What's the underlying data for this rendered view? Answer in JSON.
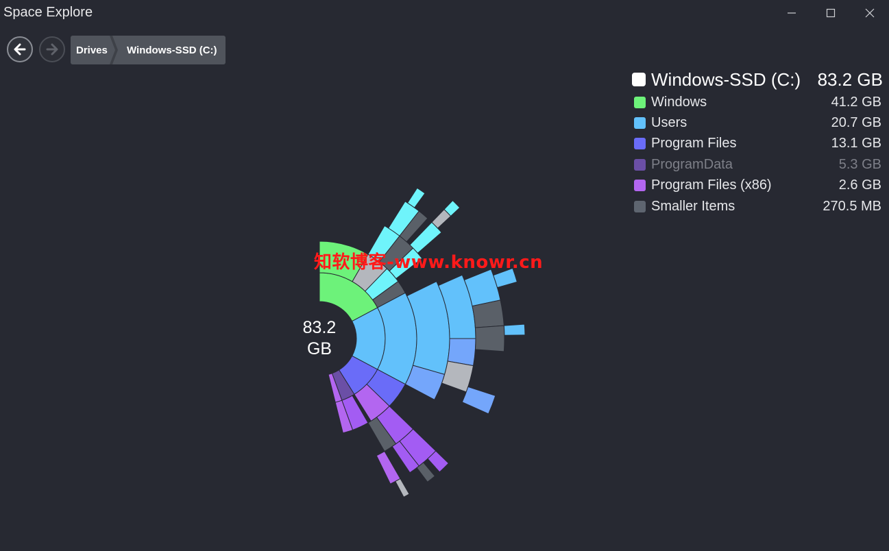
{
  "window": {
    "title": "Space Explore",
    "controls": [
      "minimize-icon",
      "maximize-icon",
      "close-icon"
    ]
  },
  "nav": {
    "back_icon": "arrow-left-icon",
    "forward_icon": "arrow-right-icon",
    "breadcrumb": [
      "Drives",
      "Windows-SSD (C:)"
    ]
  },
  "legend": {
    "root": {
      "name": "Windows-SSD (C:)",
      "size": "83.2 GB",
      "color": "#ffffff"
    },
    "items": [
      {
        "name": "Windows",
        "size": "41.2 GB",
        "color": "#6df27a"
      },
      {
        "name": "Users",
        "size": "20.7 GB",
        "color": "#62c1fb"
      },
      {
        "name": "Program Files",
        "size": "13.1 GB",
        "color": "#6a6cf8"
      },
      {
        "name": "ProgramData",
        "size": "5.3 GB",
        "color": "#6b4fa6"
      },
      {
        "name": "Program Files (x86)",
        "size": "2.6 GB",
        "color": "#b366f0"
      },
      {
        "name": "Smaller Items",
        "size": "270.5 MB",
        "color": "#5e6570"
      }
    ]
  },
  "center": {
    "line1": "83.2",
    "line2": "GB"
  },
  "watermark": "知软博客-www.knowr.cn"
}
